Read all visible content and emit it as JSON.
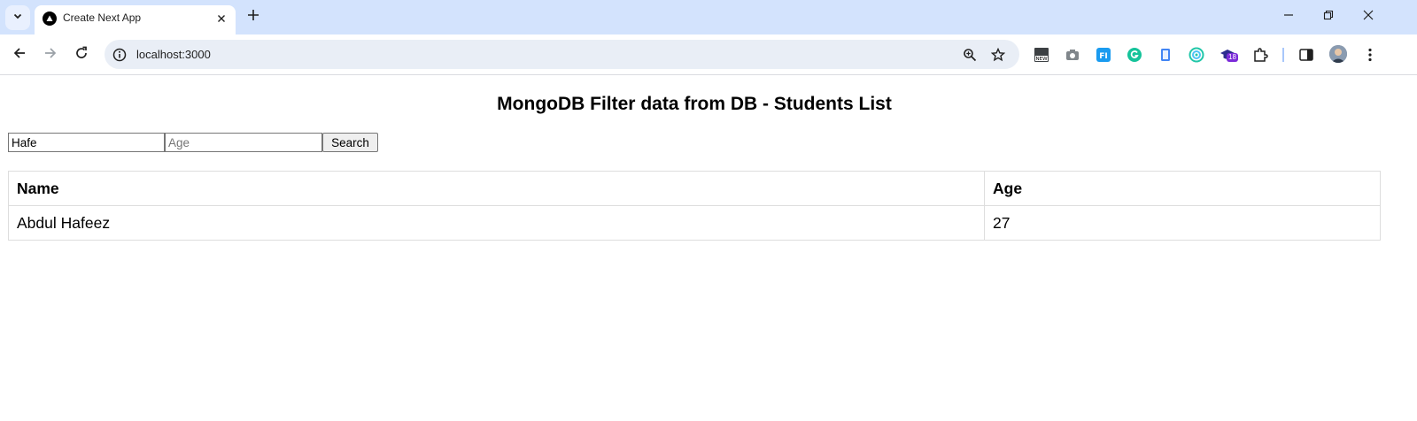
{
  "browser": {
    "tab": {
      "title": "Create Next App"
    },
    "address": {
      "url": "localhost:3000"
    },
    "extensions": [
      {
        "icon": "new-badge-extension-icon"
      },
      {
        "icon": "camera-icon"
      },
      {
        "icon": "fi-extension-icon"
      },
      {
        "icon": "grammarly-icon"
      },
      {
        "icon": "clipboard-extension-icon"
      },
      {
        "icon": "target-extension-icon"
      },
      {
        "icon": "graduation-cap-extension-icon",
        "badge": "18"
      },
      {
        "icon": "puzzle-icon"
      }
    ],
    "colors": {
      "tabstrip": "#d3e3fd",
      "omnibox": "#e9eef6"
    }
  },
  "page": {
    "title": "MongoDB Filter data from DB - Students List",
    "filter": {
      "name_value": "Hafe",
      "age_placeholder": "Age",
      "search_label": "Search"
    },
    "table": {
      "headers": [
        "Name",
        "Age"
      ],
      "rows": [
        {
          "name": "Abdul Hafeez",
          "age": "27"
        }
      ]
    }
  }
}
